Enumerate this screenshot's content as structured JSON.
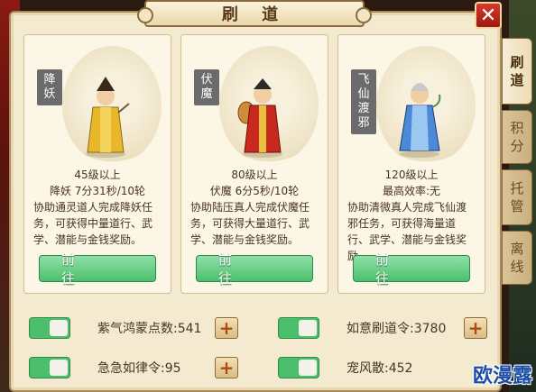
{
  "window": {
    "title": "刷 道",
    "close_glyph": "✕"
  },
  "tabs": [
    {
      "label_1": "刷",
      "label_2": "道",
      "active": true
    },
    {
      "label_1": "积",
      "label_2": "分",
      "active": false
    },
    {
      "label_1": "托",
      "label_2": "管",
      "active": false
    },
    {
      "label_1": "离",
      "label_2": "线",
      "active": false
    }
  ],
  "cards": [
    {
      "tag": [
        "降",
        "妖"
      ],
      "level": "45级以上",
      "stat": "降妖 7分31秒/10轮",
      "desc": "协助通灵道人完成降妖任务，可获得中量道行、武学、潜能与金钱奖励。",
      "button": "前 往",
      "figure_icon": "demon-subduer-figure-icon",
      "accent": "#e8b82a"
    },
    {
      "tag": [
        "伏",
        "魔"
      ],
      "level": "80级以上",
      "stat": "伏魔 6分5秒/10轮",
      "desc": "协助陆压真人完成伏魔任务，可获得大量道行、武学、潜能与金钱奖励。",
      "button": "前 往",
      "figure_icon": "demon-vanquisher-figure-icon",
      "accent": "#c8281e"
    },
    {
      "tag": [
        "飞",
        "仙",
        "渡",
        "邪"
      ],
      "level": "120级以上",
      "stat": "最高效率:无",
      "desc": "协助清微真人完成飞仙渡邪任务，可获得海量道行、武学、潜能与金钱奖励。",
      "button": "前 往",
      "figure_icon": "immortal-figure-icon",
      "accent": "#4a8ad8"
    }
  ],
  "items": [
    {
      "label": "紫气鸿蒙点数:541",
      "has_plus": true,
      "enabled": true
    },
    {
      "label": "如意刷道令:3780",
      "has_plus": true,
      "enabled": true
    },
    {
      "label": "急急如律令:95",
      "has_plus": true,
      "enabled": true
    },
    {
      "label": "宠风散:452",
      "has_plus": false,
      "enabled": true
    }
  ],
  "plus_glyph": "+",
  "watermark": "欧漫露"
}
